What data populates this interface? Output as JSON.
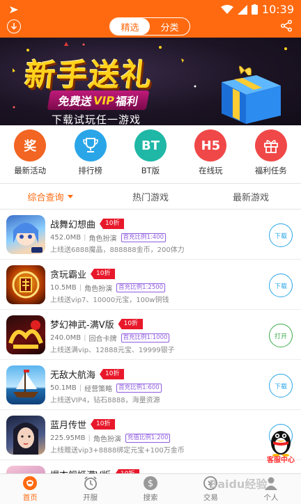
{
  "status": {
    "time": "10:39"
  },
  "header": {
    "tabs": [
      {
        "label": "精选",
        "active": true
      },
      {
        "label": "分类",
        "active": false
      }
    ]
  },
  "banner": {
    "title": "新手送礼",
    "ribbon_pre": "免费送",
    "ribbon_vip": "VIP",
    "ribbon_post": "福利",
    "subtitle": "下载试玩任一游戏"
  },
  "categories": [
    {
      "label": "最新活动",
      "icon_text": "奖",
      "color": "#f26522",
      "icon": "award-icon"
    },
    {
      "label": "排行榜",
      "icon_text": "",
      "color": "#2aa6e8",
      "icon": "trophy-icon"
    },
    {
      "label": "BT版",
      "icon_text": "BT",
      "color": "#1fb7a6",
      "icon": "bt-icon"
    },
    {
      "label": "在线玩",
      "icon_text": "H5",
      "color": "#f04848",
      "icon": "h5-icon"
    },
    {
      "label": "福利任务",
      "icon_text": "",
      "color": "#f04848",
      "icon": "gift-icon"
    }
  ],
  "tabs": [
    {
      "label": "综合查询",
      "active": true
    },
    {
      "label": "热门游戏",
      "active": false
    },
    {
      "label": "最新游戏",
      "active": false
    }
  ],
  "games": [
    {
      "name": "战舞幻想曲",
      "discount": "10折",
      "size": "452.0MB",
      "genre": "角色扮演",
      "ratio": "首充比例1:400",
      "desc": "上线送6888魔晶，888888金币，200体力",
      "action": "下载"
    },
    {
      "name": "贪玩霸业",
      "discount": "10折",
      "size": "10.5MB",
      "genre": "角色扮演",
      "ratio": "首充比例1:2500",
      "desc": "上线送vip7、10000元宝，100w铜钱",
      "action": "下载"
    },
    {
      "name": "梦幻神武-满V版",
      "discount": "10折",
      "size": "240.0MB",
      "genre": "回合卡牌",
      "ratio": "首充比例1:1000",
      "desc": "上线送满vip、12888元宝、19999银子",
      "action": "打开"
    },
    {
      "name": "无敌大航海",
      "discount": "10折",
      "size": "50.1MB",
      "genre": "经营策略",
      "ratio": "首充比例1:600",
      "desc": "上线送VIP4，钻石8888，海量资源",
      "action": "下载"
    },
    {
      "name": "蓝月传世",
      "discount": "10折",
      "size": "225.95MB",
      "genre": "角色扮演",
      "ratio": "充值比例1:200",
      "desc": "上线赠送vip3+8888绑定元宝+100万金币",
      "action": "下载"
    },
    {
      "name": "爆衣舰姬满V版",
      "discount": "10折",
      "size": "",
      "genre": "",
      "ratio": "",
      "desc": "",
      "action": ""
    }
  ],
  "floating": {
    "label": "客服中心"
  },
  "bottom_nav": [
    {
      "label": "首页",
      "active": true
    },
    {
      "label": "开服",
      "active": false
    },
    {
      "label": "搜索",
      "active": false
    },
    {
      "label": "交易",
      "active": false
    },
    {
      "label": "个人",
      "active": false
    }
  ],
  "watermark": "Baidu经验"
}
